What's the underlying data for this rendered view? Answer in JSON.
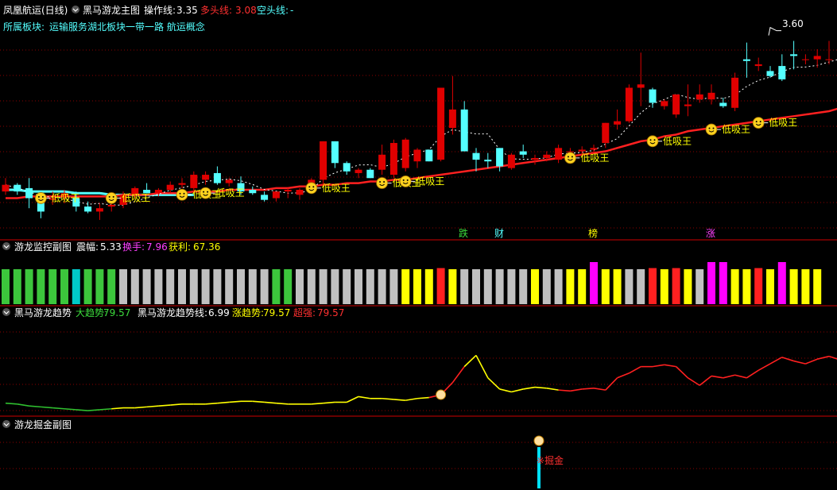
{
  "main": {
    "title": "凤凰航运(日线)",
    "indicator": "黑马游龙主图",
    "op_label": "操作线:",
    "op_value": "3.35",
    "long_label": "多头线:",
    "long_value": "3.08",
    "short_label": "空头线:",
    "short_value": "-",
    "sector_label": "所属板块:",
    "sectors": "运输服务湖北板块一带一路 航运概念",
    "high_label": "3.60",
    "signal_text": "低吸王",
    "first_signal_text": "低吸干"
  },
  "monitor": {
    "title": "游龙监控副图",
    "amp_label": "震幅:",
    "amp_value": "5.33",
    "turn_label": "换手:",
    "turn_value": "7.96",
    "profit_label": "获利:",
    "profit_value": "67.36",
    "tag_die": "跌",
    "tag_cai": "财",
    "tag_bang": "榜",
    "tag_zhang": "涨"
  },
  "trend": {
    "title": "黑马游龙趋势",
    "big_label": "大趋势:",
    "big_value": "79.57",
    "line_label": "黑马游龙趋势线:",
    "line_value": "6.99",
    "rise_label": "涨趋势:",
    "rise_value": "79.57",
    "super_label": "超强:",
    "super_value": "79.57"
  },
  "dig": {
    "title": "游龙掘金副图",
    "marker_text": "※掘金"
  },
  "colors": {
    "up": "#ff2020",
    "down": "#54ffff",
    "red_candle": "#e00000",
    "yellow": "#ffff00",
    "magenta": "#ff00ff",
    "gray": "#c0c0c0",
    "green": "#3cc63c",
    "cyan": "#00c8c8",
    "grid": "#8b0000",
    "text": "#ffffff"
  },
  "chart_data": [
    {
      "type": "candlestick",
      "title": "黑马游龙主图",
      "ohlc": [
        [
          2.62,
          2.7,
          2.6,
          2.66
        ],
        [
          2.66,
          2.67,
          2.6,
          2.62
        ],
        [
          2.64,
          2.7,
          2.52,
          2.58
        ],
        [
          2.58,
          2.62,
          2.46,
          2.5
        ],
        [
          2.57,
          2.62,
          2.54,
          2.58
        ],
        [
          2.59,
          2.63,
          2.55,
          2.61
        ],
        [
          2.58,
          2.62,
          2.5,
          2.53
        ],
        [
          2.53,
          2.56,
          2.49,
          2.5
        ],
        [
          2.5,
          2.55,
          2.45,
          2.52
        ],
        [
          2.53,
          2.56,
          2.5,
          2.54
        ],
        [
          2.54,
          2.62,
          2.52,
          2.6
        ],
        [
          2.6,
          2.65,
          2.58,
          2.64
        ],
        [
          2.63,
          2.67,
          2.61,
          2.61
        ],
        [
          2.61,
          2.64,
          2.59,
          2.63
        ],
        [
          2.63,
          2.68,
          2.61,
          2.66
        ],
        [
          2.66,
          2.7,
          2.64,
          2.67
        ],
        [
          2.64,
          2.74,
          2.62,
          2.72
        ],
        [
          2.69,
          2.74,
          2.66,
          2.72
        ],
        [
          2.73,
          2.77,
          2.66,
          2.67
        ],
        [
          2.67,
          2.7,
          2.65,
          2.69
        ],
        [
          2.67,
          2.71,
          2.6,
          2.62
        ],
        [
          2.63,
          2.65,
          2.6,
          2.61
        ],
        [
          2.6,
          2.62,
          2.56,
          2.57
        ],
        [
          2.58,
          2.62,
          2.56,
          2.62
        ],
        [
          2.62,
          2.64,
          2.58,
          2.63
        ],
        [
          2.6,
          2.64,
          2.57,
          2.63
        ],
        [
          2.63,
          2.7,
          2.62,
          2.69
        ],
        [
          2.69,
          2.92,
          2.66,
          2.92
        ],
        [
          2.92,
          2.92,
          2.76,
          2.79
        ],
        [
          2.79,
          2.8,
          2.72,
          2.74
        ],
        [
          2.73,
          2.76,
          2.7,
          2.75
        ],
        [
          2.75,
          2.76,
          2.7,
          2.7
        ],
        [
          2.75,
          2.9,
          2.72,
          2.84
        ],
        [
          2.72,
          2.93,
          2.7,
          2.91
        ],
        [
          2.76,
          2.94,
          2.74,
          2.93
        ],
        [
          2.8,
          2.88,
          2.76,
          2.87
        ],
        [
          2.87,
          2.87,
          2.8,
          2.8
        ],
        [
          2.81,
          3.24,
          2.8,
          3.24
        ],
        [
          3.0,
          3.31,
          2.96,
          3.11
        ],
        [
          3.11,
          3.16,
          2.86,
          2.86
        ],
        [
          2.85,
          2.88,
          2.74,
          2.81
        ],
        [
          2.81,
          2.85,
          2.76,
          2.8
        ],
        [
          2.88,
          2.88,
          2.74,
          2.77
        ],
        [
          2.76,
          2.85,
          2.75,
          2.84
        ],
        [
          2.86,
          2.9,
          2.82,
          2.84
        ],
        [
          2.81,
          2.84,
          2.78,
          2.82
        ],
        [
          2.82,
          2.86,
          2.8,
          2.84
        ],
        [
          2.81,
          2.9,
          2.79,
          2.88
        ],
        [
          2.86,
          2.88,
          2.82,
          2.86
        ],
        [
          2.86,
          2.89,
          2.84,
          2.87
        ],
        [
          2.87,
          2.9,
          2.85,
          2.88
        ],
        [
          2.91,
          3.03,
          2.88,
          3.03
        ],
        [
          3.02,
          3.11,
          2.99,
          3.04
        ],
        [
          3.04,
          3.26,
          3.03,
          3.24
        ],
        [
          3.24,
          3.45,
          3.13,
          3.26
        ],
        [
          3.23,
          3.24,
          3.12,
          3.15
        ],
        [
          3.13,
          3.17,
          3.11,
          3.16
        ],
        [
          3.08,
          3.2,
          3.06,
          3.2
        ],
        [
          3.13,
          3.26,
          3.07,
          3.14
        ],
        [
          3.17,
          3.26,
          3.15,
          3.2
        ],
        [
          3.17,
          3.26,
          3.14,
          3.21
        ],
        [
          3.15,
          3.18,
          3.12,
          3.13
        ],
        [
          3.12,
          3.33,
          3.1,
          3.3
        ],
        [
          3.41,
          3.51,
          3.3,
          3.4
        ],
        [
          3.37,
          3.42,
          3.34,
          3.38
        ],
        [
          3.34,
          3.37,
          3.3,
          3.31
        ],
        [
          3.37,
          3.44,
          3.28,
          3.29
        ],
        [
          3.44,
          3.52,
          3.35,
          3.43
        ],
        [
          3.41,
          3.44,
          3.38,
          3.41
        ],
        [
          3.41,
          3.47,
          3.36,
          3.43
        ],
        [
          3.41,
          3.52,
          3.38,
          3.41
        ],
        [
          3.42,
          3.45,
          3.37,
          3.39
        ]
      ],
      "long_line": [
        2.58,
        2.58,
        2.59,
        2.59,
        2.59,
        2.59,
        2.59,
        2.59,
        2.59,
        2.59,
        2.6,
        2.6,
        2.6,
        2.61,
        2.61,
        2.61,
        2.62,
        2.62,
        2.62,
        2.63,
        2.63,
        2.63,
        2.63,
        2.64,
        2.64,
        2.65,
        2.65,
        2.66,
        2.66,
        2.67,
        2.67,
        2.68,
        2.68,
        2.69,
        2.69,
        2.7,
        2.71,
        2.72,
        2.73,
        2.74,
        2.75,
        2.76,
        2.77,
        2.78,
        2.79,
        2.8,
        2.81,
        2.82,
        2.83,
        2.84,
        2.85,
        2.86,
        2.88,
        2.9,
        2.92,
        2.93,
        2.95,
        2.96,
        2.98,
        2.99,
        3.0,
        3.01,
        3.02,
        3.03,
        3.04,
        3.05,
        3.06,
        3.07,
        3.08,
        3.09,
        3.1,
        3.12
      ],
      "short_line": [
        2.63,
        2.63,
        2.62,
        2.62,
        2.62,
        2.62,
        2.61,
        2.61,
        2.61,
        2.6,
        2.6,
        2.6,
        2.6,
        2.6,
        2.6,
        2.6,
        2.6,
        null,
        null,
        null,
        null,
        null,
        null,
        null,
        null,
        null,
        null,
        null,
        null,
        null,
        null,
        null,
        null,
        null,
        null,
        null,
        null,
        null,
        null,
        null,
        null,
        null,
        null,
        null,
        null,
        null,
        null,
        null,
        null,
        null,
        null,
        null,
        null,
        null,
        null,
        null,
        null,
        null,
        null,
        null,
        null,
        null,
        null,
        null,
        null,
        null,
        null,
        null,
        null,
        null,
        null,
        null
      ],
      "ylim": [
        2.35,
        3.66
      ],
      "high_marker": 3.6
    },
    {
      "type": "bar",
      "title": "游龙监控副图",
      "colors": [
        "green",
        "green",
        "green",
        "green",
        "green",
        "green",
        "cyan",
        "green",
        "green",
        "green",
        "gray",
        "gray",
        "gray",
        "gray",
        "gray",
        "gray",
        "gray",
        "gray",
        "gray",
        "gray",
        "gray",
        "gray",
        "gray",
        "green",
        "green",
        "gray",
        "gray",
        "gray",
        "gray",
        "gray",
        "gray",
        "gray",
        "gray",
        "gray",
        "yellow",
        "yellow",
        "yellow",
        "red",
        "yellow",
        "gray",
        "gray",
        "gray",
        "gray",
        "gray",
        "gray",
        "yellow",
        "gray",
        "gray",
        "yellow",
        "yellow",
        "magenta",
        "yellow",
        "yellow",
        "gray",
        "gray",
        "red",
        "yellow",
        "red",
        "yellow",
        "gray",
        "magenta",
        "magenta",
        "yellow",
        "yellow",
        "red",
        "yellow",
        "magenta",
        "yellow",
        "yellow",
        "yellow"
      ],
      "values": [
        1,
        1,
        1,
        1,
        1,
        1,
        1,
        1,
        1,
        1,
        1,
        1,
        1,
        1,
        1,
        1,
        1,
        1,
        1,
        1,
        1,
        1,
        1,
        1,
        1,
        1,
        1,
        1,
        1,
        1,
        1,
        1,
        1,
        1,
        1,
        1,
        1,
        1.2,
        1,
        1,
        1,
        1,
        1,
        1,
        1,
        1,
        1,
        1,
        1,
        1,
        1.4,
        1,
        1,
        1,
        1,
        1.2,
        1,
        1.2,
        1,
        1,
        1.4,
        1.4,
        1,
        1,
        1.2,
        1,
        1.4,
        1,
        1,
        1
      ]
    },
    {
      "type": "line",
      "title": "黑马游龙趋势",
      "values": [
        13,
        12,
        10,
        9,
        8,
        7,
        6,
        5,
        6,
        7,
        8,
        8,
        9,
        10,
        11,
        12,
        12,
        12,
        13,
        14,
        15,
        15,
        14,
        13,
        12,
        12,
        12,
        13,
        14,
        14,
        20,
        18,
        18,
        17,
        16,
        18,
        19,
        22,
        35,
        52,
        64,
        40,
        28,
        25,
        28,
        30,
        29,
        27,
        26,
        28,
        29,
        27,
        40,
        45,
        52,
        52,
        54,
        52,
        40,
        32,
        42,
        40,
        43,
        40,
        48,
        55,
        62,
        58,
        55,
        60,
        63,
        59
      ],
      "segment_colors": [
        "green",
        "yellow",
        "red"
      ],
      "ylim": [
        0,
        100
      ]
    },
    {
      "type": "bar",
      "title": "游龙掘金副图",
      "marker_index": 45
    }
  ]
}
